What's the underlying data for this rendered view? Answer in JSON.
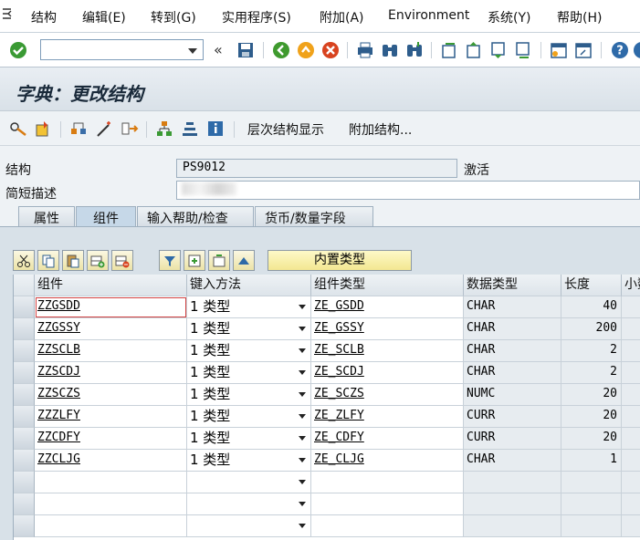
{
  "menu": {
    "items": [
      "结构",
      "编辑(E)",
      "转到(G)",
      "实用程序(S)",
      "附加(A)",
      "Environment",
      "系统(Y)",
      "帮助(H)"
    ]
  },
  "toolbar": {
    "command_field": "",
    "icons": [
      "check-icon",
      "save-icon",
      "back-icon",
      "exit-icon",
      "cancel-icon",
      "print-icon",
      "find-icon",
      "find-next-icon",
      "first-page-icon",
      "prev-page-icon",
      "next-page-icon",
      "last-page-icon",
      "new-session-icon",
      "shortcut-icon",
      "help-icon"
    ]
  },
  "title": "字典：更改结构",
  "app_toolbar": {
    "hierarchy_label": "层次结构显示",
    "append_label": "附加结构..."
  },
  "header": {
    "structure_label": "结构",
    "structure_value": "PS9012",
    "status_value": "激活",
    "short_desc_label": "简短描述",
    "short_desc_value": ""
  },
  "tabs": [
    "属性",
    "组件",
    "输入帮助/检查",
    "货币/数量字段"
  ],
  "active_tab": "组件",
  "table_toolbar": {
    "builtin_type_label": "内置类型"
  },
  "table": {
    "columns": [
      "组件",
      "键入方法",
      "组件类型",
      "数据类型",
      "长度",
      "小数"
    ],
    "rows": [
      {
        "component": "ZZGSDD",
        "method": "1 类型",
        "type": "ZE_GSDD",
        "datatype": "CHAR",
        "length": "40"
      },
      {
        "component": "ZZGSSY",
        "method": "1 类型",
        "type": "ZE_GSSY",
        "datatype": "CHAR",
        "length": "200"
      },
      {
        "component": "ZZSCLB",
        "method": "1 类型",
        "type": "ZE_SCLB",
        "datatype": "CHAR",
        "length": "2"
      },
      {
        "component": "ZZSCDJ",
        "method": "1 类型",
        "type": "ZE_SCDJ",
        "datatype": "CHAR",
        "length": "2"
      },
      {
        "component": "ZZSCZS",
        "method": "1 类型",
        "type": "ZE_SCZS",
        "datatype": "NUMC",
        "length": "20"
      },
      {
        "component": "ZZZLFY",
        "method": "1 类型",
        "type": "ZE_ZLFY",
        "datatype": "CURR",
        "length": "20"
      },
      {
        "component": "ZZCDFY",
        "method": "1 类型",
        "type": "ZE_CDFY",
        "datatype": "CURR",
        "length": "20"
      },
      {
        "component": "ZZCLJG",
        "method": "1 类型",
        "type": "ZE_CLJG",
        "datatype": "CHAR",
        "length": "1"
      }
    ]
  }
}
